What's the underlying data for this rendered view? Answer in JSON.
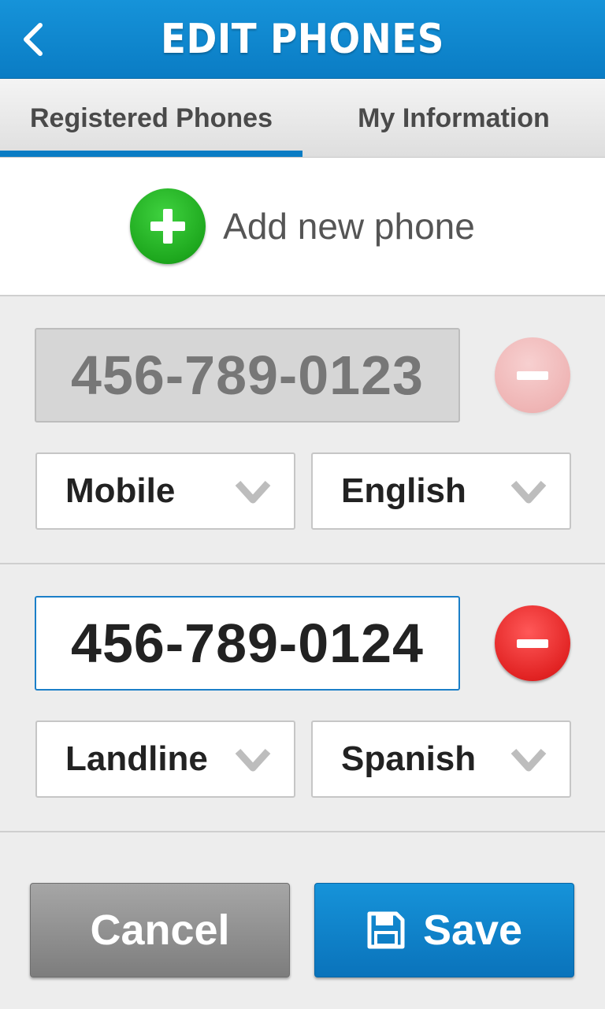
{
  "header": {
    "title": "EDIT PHONES",
    "back_icon": "chevron-left-icon"
  },
  "tabs": [
    {
      "label": "Registered Phones",
      "selected": true
    },
    {
      "label": "My Information",
      "selected": false
    }
  ],
  "add_phone": {
    "label": "Add new phone",
    "icon": "plus-circle-icon",
    "icon_color": "#22b022"
  },
  "phones": [
    {
      "number": "456-789-0123",
      "enabled": false,
      "type": "Mobile",
      "language": "English",
      "remove_icon": "minus-circle-icon"
    },
    {
      "number": "456-789-0124",
      "enabled": true,
      "type": "Landline",
      "language": "Spanish",
      "remove_icon": "minus-circle-icon"
    }
  ],
  "actions": {
    "cancel_label": "Cancel",
    "save_label": "Save",
    "save_icon": "floppy-disk-icon"
  },
  "colors": {
    "accent": "#0a7cc4",
    "remove_active": "#e22424",
    "remove_disabled": "#efb5b5"
  }
}
